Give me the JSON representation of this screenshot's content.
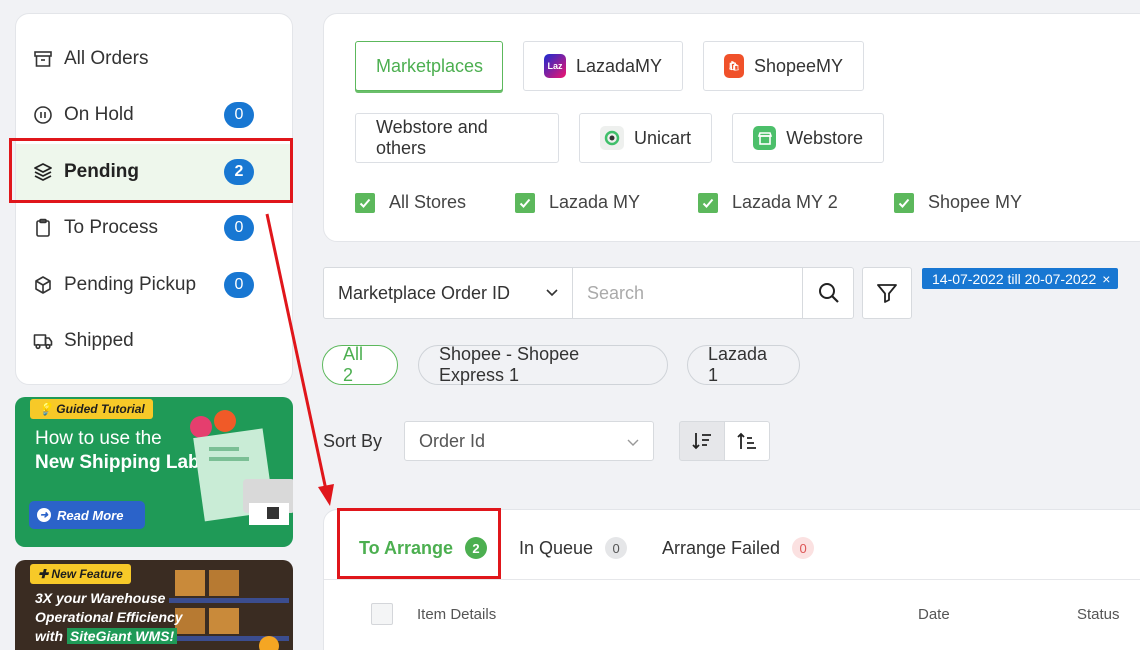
{
  "sidebar": {
    "items": [
      {
        "label": "All Orders",
        "icon": "archive-box-icon",
        "badge": null
      },
      {
        "label": "On Hold",
        "icon": "pause-circle-icon",
        "badge": "0"
      },
      {
        "label": "Pending",
        "icon": "layers-icon",
        "badge": "2"
      },
      {
        "label": "To Process",
        "icon": "clipboard-icon",
        "badge": "0"
      },
      {
        "label": "Pending Pickup",
        "icon": "box-icon",
        "badge": "0"
      },
      {
        "label": "Shipped",
        "icon": "truck-icon",
        "badge": null
      }
    ]
  },
  "promos": {
    "tutorial": {
      "tag": "Guided Tutorial",
      "line1": "How to use the",
      "line2": "New Shipping Label?",
      "button": "Read More"
    },
    "feature": {
      "tag": "New Feature",
      "line1": "3X your Warehouse",
      "line2": "Operational Efficiency",
      "line3_prefix": "with",
      "line3_highlight": "SiteGiant WMS!"
    }
  },
  "stores": {
    "marketplaces_label": "Marketplaces",
    "lazada_label": "LazadaMY",
    "shopee_label": "ShopeeMY",
    "webstore_others_label": "Webstore and others",
    "unicart_label": "Unicart",
    "webstore_label": "Webstore",
    "lazada_logo_text": "Laz",
    "checkboxes": [
      "All Stores",
      "Lazada MY",
      "Lazada MY 2",
      "Shopee MY"
    ]
  },
  "search": {
    "field": "Marketplace Order ID",
    "placeholder": "Search",
    "date_range": "14-07-2022 till 20-07-2022",
    "date_close": "×"
  },
  "pills": [
    "All 2",
    "Shopee - Shopee Express 1",
    "Lazada 1"
  ],
  "sort": {
    "label": "Sort By",
    "value": "Order Id"
  },
  "orders": {
    "tabs": [
      {
        "label": "To Arrange",
        "count": "2"
      },
      {
        "label": "In Queue",
        "count": "0"
      },
      {
        "label": "Arrange Failed",
        "count": "0"
      }
    ],
    "columns": [
      "Item Details",
      "Date",
      "Status"
    ]
  },
  "colors": {
    "accent_green": "#4caf50",
    "badge_blue": "#1877d2",
    "annotation_red": "#e0161b"
  }
}
